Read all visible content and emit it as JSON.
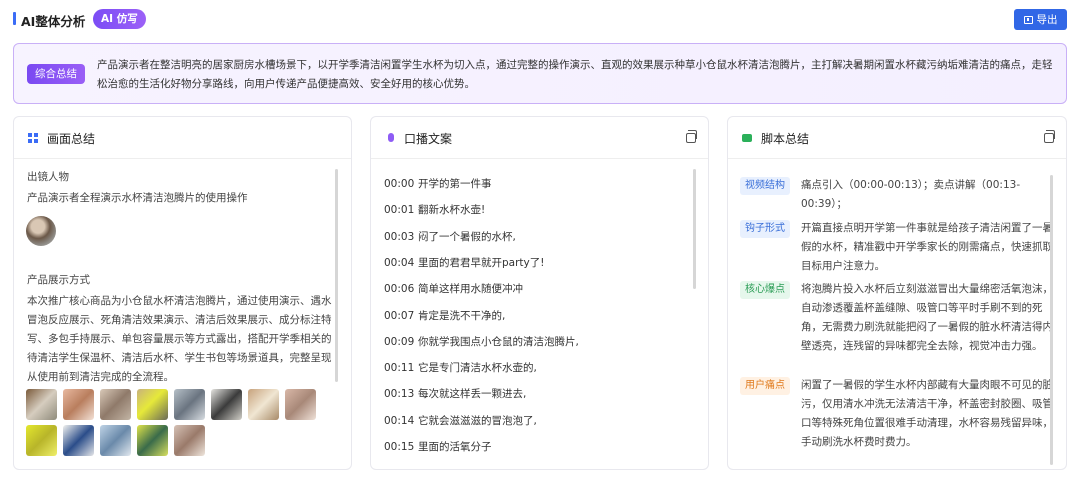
{
  "header": {
    "title": "AI整体分析",
    "ai_badge": "AI 仿写",
    "export_label": "导出"
  },
  "summary": {
    "tag": "综合总结",
    "text": "产品演示者在整洁明亮的居家厨房水槽场景下，以开学季清洁闲置学生水杯为切入点，通过完整的操作演示、直观的效果展示种草小仓鼠水杯清洁泡腾片，主打解决暑期闲置水杯藏污纳垢难清洁的痛点，走轻松治愈的生活化好物分享路线，向用户传递产品便捷高效、安全好用的核心优势。"
  },
  "cards": {
    "visual": {
      "title": "画面总结",
      "people_label": "出镜人物",
      "people_text": "产品演示者全程演示水杯清洁泡腾片的使用操作",
      "display_label": "产品展示方式",
      "display_text": "本次推广核心商品为小仓鼠水杯清洁泡腾片，通过使用演示、遇水冒泡反应展示、死角清洁效果演示、清洁后效果展示、成分标注特写、多包手持展示、单包容量展示等方式露出，搭配开学季相关的待清洁学生保温杯、清洁后水杯、学生书包等场景道具，完整呈现从使用前到清洁完成的全流程。"
    },
    "script": {
      "title": "口播文案",
      "lines": [
        {
          "time": "00:00",
          "text": "开学的第一件事"
        },
        {
          "time": "00:01",
          "text": "翻新水杯水壶!"
        },
        {
          "time": "00:03",
          "text": "闷了一个暑假的水杯,"
        },
        {
          "time": "00:04",
          "text": "里面的君君早就开party了!"
        },
        {
          "time": "00:06",
          "text": "简单这样用水随便冲冲"
        },
        {
          "time": "00:07",
          "text": "肯定是洗不干净的,"
        },
        {
          "time": "00:09",
          "text": "你就学我围点小仓鼠的清洁泡腾片,"
        },
        {
          "time": "00:11",
          "text": "它是专门清洁水杯水壶的,"
        },
        {
          "time": "00:13",
          "text": "每次就这样丢一颗进去,"
        },
        {
          "time": "00:14",
          "text": "它就会滋滋滋的冒泡泡了,"
        },
        {
          "time": "00:15",
          "text": "里面的活氧分子"
        }
      ]
    },
    "scriptsum": {
      "title": "脚本总结",
      "rows": [
        {
          "tag": "视频结构",
          "text": "痛点引入（00:00-00:13）；卖点讲解（00:13-00:39）；"
        },
        {
          "tag": "钩子形式",
          "text": "开篇直接点明开学第一件事就是给孩子清洁闲置了一暑假的水杯，精准戳中开学季家长的刚需痛点，快速抓取目标用户注意力。"
        },
        {
          "tag": "核心爆点",
          "text": "将泡腾片投入水杯后立刻滋滋冒出大量绵密活氧泡沫，自动渗透覆盖杯盖缝隙、吸管口等平时手刷不到的死角，无需费力刷洗就能把闷了一暑假的脏水杯清洁得内壁透亮，连残留的异味都完全去除，视觉冲击力强。"
        },
        {
          "tag": "用户痛点",
          "text": "闲置了一暑假的学生水杯内部藏有大量肉眼不可见的脏污，仅用清水冲洗无法清洁干净，杯盖密封胶圈、吸管口等特殊死角位置很难手动清理，水杯容易残留异味，手动刷洗水杯费时费力。"
        }
      ]
    }
  },
  "colors": {
    "accent": "#3167e6",
    "purple": "#8a55f5",
    "tag_blue_bg": "#e8f0fe",
    "tag_blue_fg": "#3a6fd8",
    "tag_green_bg": "#e6f7ec",
    "tag_green_fg": "#2a9c55",
    "tag_orange_bg": "#fff1e3",
    "tag_orange_fg": "#e07b1e"
  }
}
